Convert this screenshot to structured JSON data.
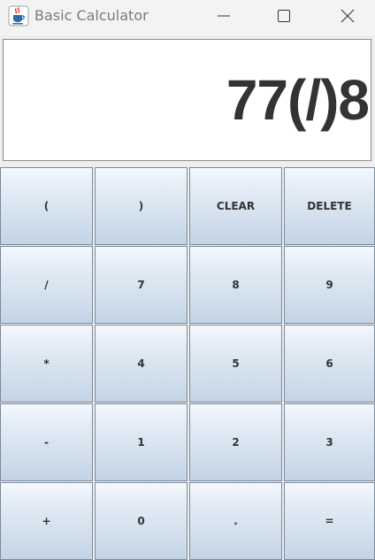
{
  "window": {
    "title": "Basic Calculator",
    "icon": "java-cup-icon"
  },
  "display": {
    "expression": "77(/)8"
  },
  "keypad": {
    "rows": [
      [
        "(",
        ")",
        "CLEAR",
        "DELETE"
      ],
      [
        "/",
        "7",
        "8",
        "9"
      ],
      [
        "*",
        "4",
        "5",
        "6"
      ],
      [
        "-",
        "1",
        "2",
        "3"
      ],
      [
        "+",
        "0",
        ".",
        "="
      ]
    ]
  },
  "colors": {
    "display_text": "#333333",
    "button_gradient_top": "#f5f9fd",
    "button_gradient_bottom": "#c3d4e6",
    "button_border": "#7a8a99",
    "window_background": "#eeeeee"
  }
}
